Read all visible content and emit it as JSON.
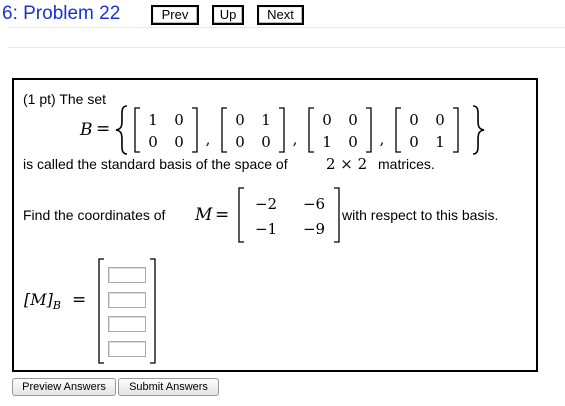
{
  "header": {
    "title": "6: Problem 22",
    "prev_label": "Prev",
    "up_label": "Up",
    "next_label": "Next"
  },
  "problem": {
    "intro": "(1 pt) The set",
    "basis_symbol": "B",
    "equals": "=",
    "matrices": [
      [
        [
          "1",
          "0"
        ],
        [
          "0",
          "0"
        ]
      ],
      [
        [
          "0",
          "1"
        ],
        [
          "0",
          "0"
        ]
      ],
      [
        [
          "0",
          "0"
        ],
        [
          "1",
          "0"
        ]
      ],
      [
        [
          "0",
          "0"
        ],
        [
          "0",
          "1"
        ]
      ]
    ],
    "comma": ",",
    "statement_before": "is called the standard basis of the space of",
    "dim": "2 × 2",
    "statement_after": "matrices.",
    "find_label": "Find the coordinates of",
    "M_symbol": "M",
    "M_matrix": [
      [
        "−2",
        "−6"
      ],
      [
        "−1",
        "−9"
      ]
    ],
    "with_respect": "with respect to this basis.",
    "answer_label_main": "[M]",
    "answer_label_sub": "B",
    "answer_equals": "=",
    "answer_values": [
      "",
      "",
      "",
      ""
    ]
  },
  "footer": {
    "preview_label": "Preview Answers",
    "submit_label": "Submit Answers"
  },
  "colors": {
    "title": "#1a33cc",
    "border": "#000000"
  }
}
